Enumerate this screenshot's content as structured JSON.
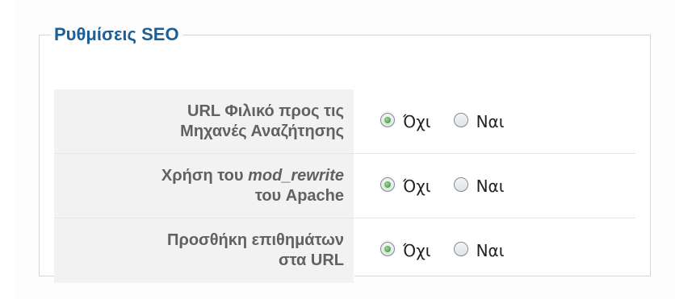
{
  "fieldset": {
    "legend": "Ρυθμίσεις SEO"
  },
  "rows": [
    {
      "label_line1": "URL Φιλικό προς τις",
      "label_line2": "Μηχανές Αναζήτησης",
      "options": [
        {
          "label": "Όχι",
          "checked": true
        },
        {
          "label": "Ναι",
          "checked": false
        }
      ]
    },
    {
      "label_line1_prefix": "Χρήση του ",
      "label_line1_italic": "mod_rewrite",
      "label_line2": "του Apache",
      "options": [
        {
          "label": "Όχι",
          "checked": true
        },
        {
          "label": "Ναι",
          "checked": false
        }
      ]
    },
    {
      "label_line1": "Προσθήκη επιθημάτων",
      "label_line2": "στα URL",
      "options": [
        {
          "label": "Όχι",
          "checked": true
        },
        {
          "label": "Ναι",
          "checked": false
        }
      ]
    }
  ],
  "colors": {
    "legend": "#1b5f96",
    "label_text": "#616161",
    "label_bg": "#f2f2f2",
    "radio_selected": "#3a9a36"
  }
}
